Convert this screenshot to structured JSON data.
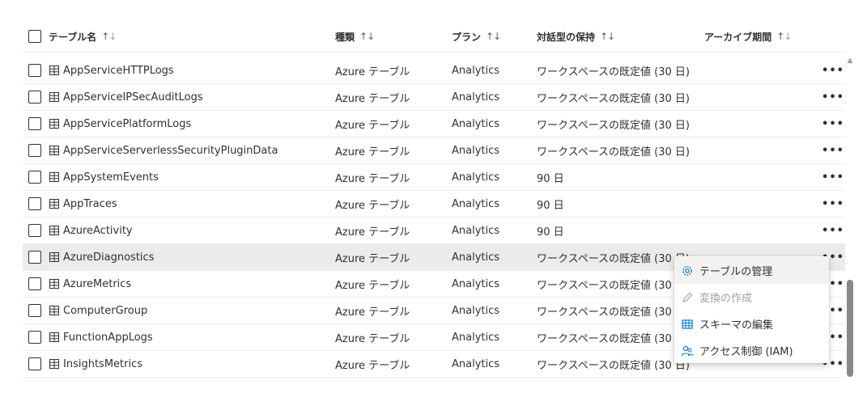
{
  "table": {
    "columns": [
      {
        "label": "テーブル名",
        "sort": "↑↓"
      },
      {
        "label": "種類",
        "sort": "↑↓"
      },
      {
        "label": "プラン",
        "sort": "↑↓"
      },
      {
        "label": "対話型の保持",
        "sort": "↑↓"
      },
      {
        "label": "アーカイブ期間",
        "sort": "↑↓"
      }
    ],
    "rows": [
      {
        "name": "AppServiceHTTPLogs",
        "type": "Azure テーブル",
        "plan": "Analytics",
        "retention": "ワークスペースの既定値 (30 日)",
        "more": "•••"
      },
      {
        "name": "AppServiceIPSecAuditLogs",
        "type": "Azure テーブル",
        "plan": "Analytics",
        "retention": "ワークスペースの既定値 (30 日)",
        "more": "•••"
      },
      {
        "name": "AppServicePlatformLogs",
        "type": "Azure テーブル",
        "plan": "Analytics",
        "retention": "ワークスペースの既定値 (30 日)",
        "more": "•••"
      },
      {
        "name": "AppServiceServerlessSecurityPluginData",
        "type": "Azure テーブル",
        "plan": "Analytics",
        "retention": "ワークスペースの既定値 (30 日)",
        "more": "•••"
      },
      {
        "name": "AppSystemEvents",
        "type": "Azure テーブル",
        "plan": "Analytics",
        "retention": "90 日",
        "more": "•••"
      },
      {
        "name": "AppTraces",
        "type": "Azure テーブル",
        "plan": "Analytics",
        "retention": "90 日",
        "more": "•••"
      },
      {
        "name": "AzureActivity",
        "type": "Azure テーブル",
        "plan": "Analytics",
        "retention": "90 日",
        "more": "•••"
      },
      {
        "name": "AzureDiagnostics",
        "type": "Azure テーブル",
        "plan": "Analytics",
        "retention": "ワークスペースの既定値 (30 日)",
        "more": "•••"
      },
      {
        "name": "AzureMetrics",
        "type": "Azure テーブル",
        "plan": "Analytics",
        "retention": "ワークスペースの既定値 (30 日)",
        "more": "•••"
      },
      {
        "name": "ComputerGroup",
        "type": "Azure テーブル",
        "plan": "Analytics",
        "retention": "ワークスペースの既定値 (30 日)",
        "more": "•••"
      },
      {
        "name": "FunctionAppLogs",
        "type": "Azure テーブル",
        "plan": "Analytics",
        "retention": "ワークスペースの既定値 (30 日)",
        "more": "•••"
      },
      {
        "name": "InsightsMetrics",
        "type": "Azure テーブル",
        "plan": "Analytics",
        "retention": "ワークスペースの既定値 (30 日)",
        "more": "•••"
      }
    ]
  },
  "context_menu": {
    "items": [
      {
        "label": "テーブルの管理",
        "icon": "gear-icon"
      },
      {
        "label": "変換の作成",
        "icon": "pencil-icon"
      },
      {
        "label": "スキーマの編集",
        "icon": "table-icon"
      },
      {
        "label": "アクセス制御 (IAM)",
        "icon": "people-icon"
      }
    ]
  },
  "colors": {
    "accent": "#0078d4",
    "selected_row": "#edebe9",
    "disabled_text": "#a19f9d"
  }
}
